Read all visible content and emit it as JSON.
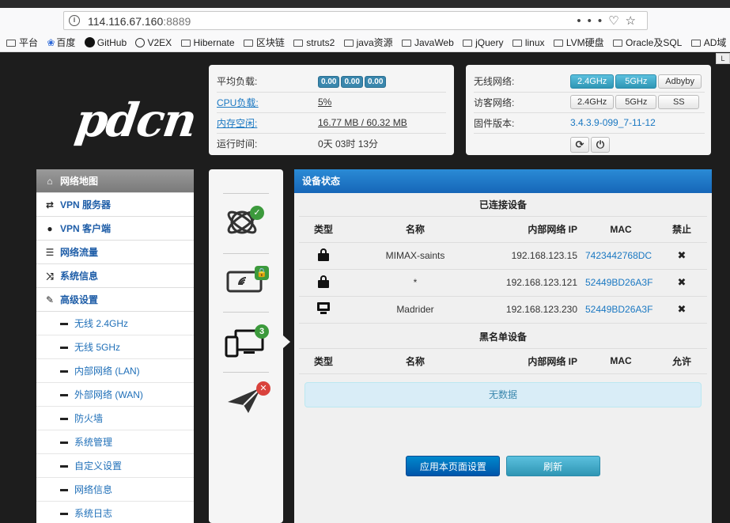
{
  "browser": {
    "url_host": "114.116.67.160",
    "url_port": ":8889",
    "bookmarks": [
      "平台",
      "百度",
      "GitHub",
      "V2EX",
      "Hibernate",
      "区块链",
      "struts2",
      "java资源",
      "JavaWeb",
      "jQuery",
      "linux",
      "LVM硬盘",
      "Oracle及SQL",
      "AD域"
    ],
    "side_tab": "L"
  },
  "logo": "pdcn",
  "status": {
    "load_label": "平均负载:",
    "load_values": [
      "0.00",
      "0.00",
      "0.00"
    ],
    "cpu_label": "CPU负载:",
    "cpu_value": "5%",
    "mem_label": "内存空闲:",
    "mem_value": "16.77 MB / 60.32 MB",
    "uptime_label": "运行时间:",
    "uptime_value": "0天 03时 13分"
  },
  "network": {
    "wireless_label": "无线网络:",
    "wireless_buttons": [
      "2.4GHz",
      "5GHz",
      "Adbyby"
    ],
    "guest_label": "访客网络:",
    "guest_buttons": [
      "2.4GHz",
      "5GHz",
      "SS"
    ],
    "firmware_label": "固件版本:",
    "firmware_value": "3.4.3.9-099_7-11-12"
  },
  "sidebar": {
    "items": [
      {
        "label": "网络地图",
        "icon": "home-icon"
      },
      {
        "label": "VPN 服务器",
        "icon": "retweet-icon"
      },
      {
        "label": "VPN 客户端",
        "icon": "globe-icon"
      },
      {
        "label": "网络流量",
        "icon": "list-icon"
      },
      {
        "label": "系统信息",
        "icon": "random-icon"
      },
      {
        "label": "高级设置",
        "icon": "wrench-icon"
      }
    ],
    "subitems": [
      "无线 2.4GHz",
      "无线 5GHz",
      "内部网络 (LAN)",
      "外部网络 (WAN)",
      "防火墙",
      "系统管理",
      "自定义设置",
      "网络信息",
      "系统日志"
    ]
  },
  "icons": {
    "devices_count": "3"
  },
  "main": {
    "title": "设备状态",
    "connected_title": "已连接设备",
    "blacklist_title": "黑名单设备",
    "col_type": "类型",
    "col_name": "名称",
    "col_ip": "内部网络 IP",
    "col_mac": "MAC",
    "col_block": "禁止",
    "col_allow": "允许",
    "devices": [
      {
        "type": "lock",
        "name": "MIMAX-saints",
        "ip": "192.168.123.15",
        "mac": "7423442768DC"
      },
      {
        "type": "lock",
        "name": "*",
        "ip": "192.168.123.121",
        "mac": "52449BD26A3F"
      },
      {
        "type": "desktop",
        "name": "Madrider",
        "ip": "192.168.123.230",
        "mac": "52449BD26A3F"
      }
    ],
    "no_data": "无数据",
    "apply_label": "应用本页面设置",
    "refresh_label": "刷新"
  }
}
